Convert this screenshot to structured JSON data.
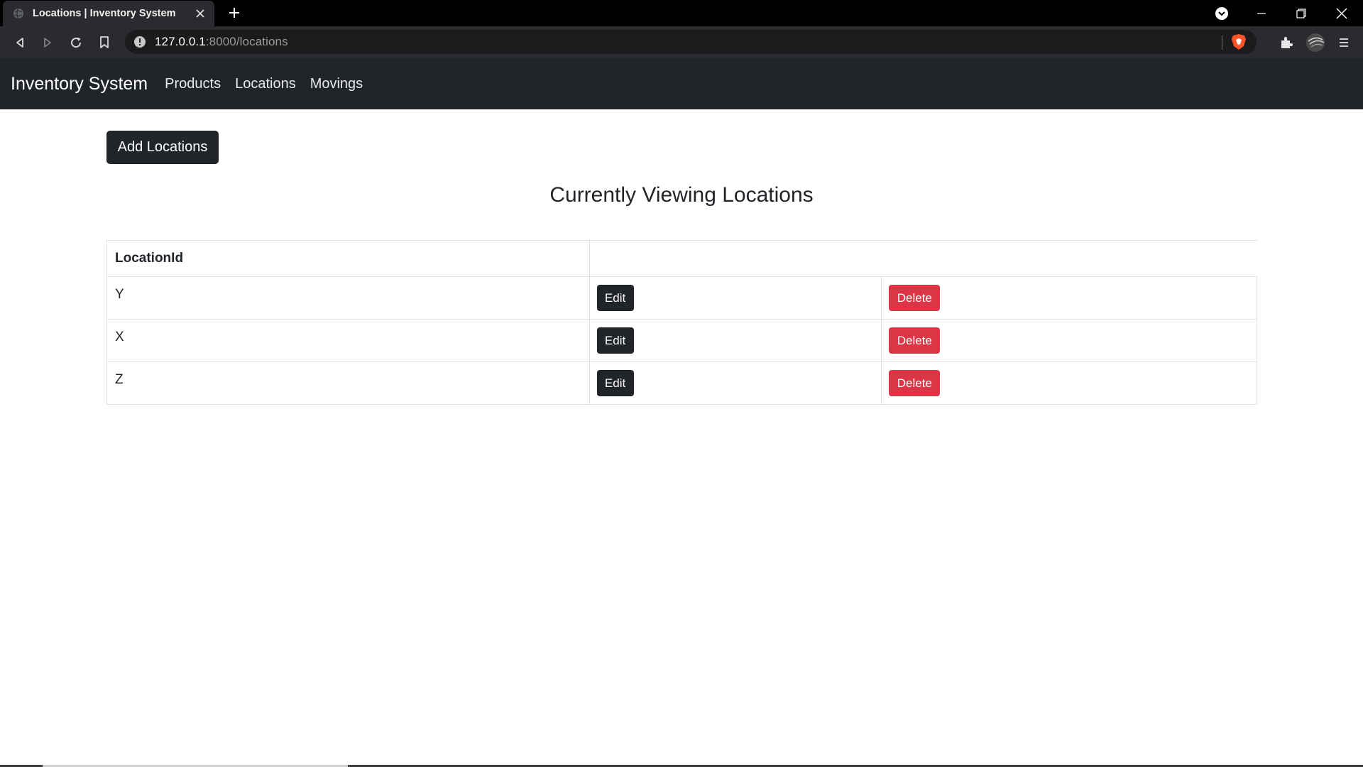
{
  "browser": {
    "tab_title": "Locations | Inventory System",
    "url_host": "127.0.0.1",
    "url_rest": ":8000/locations"
  },
  "navbar": {
    "brand": "Inventory System",
    "links": [
      "Products",
      "Locations",
      "Movings"
    ]
  },
  "page": {
    "add_button": "Add Locations",
    "title": "Currently Viewing Locations"
  },
  "table": {
    "header": "LocationId",
    "rows": [
      {
        "id": "Y",
        "edit": "Edit",
        "delete": "Delete"
      },
      {
        "id": "X",
        "edit": "Edit",
        "delete": "Delete"
      },
      {
        "id": "Z",
        "edit": "Edit",
        "delete": "Delete"
      }
    ]
  },
  "colors": {
    "navbar_bg": "#212529",
    "danger": "#dc3545",
    "dark_button": "#212529"
  }
}
